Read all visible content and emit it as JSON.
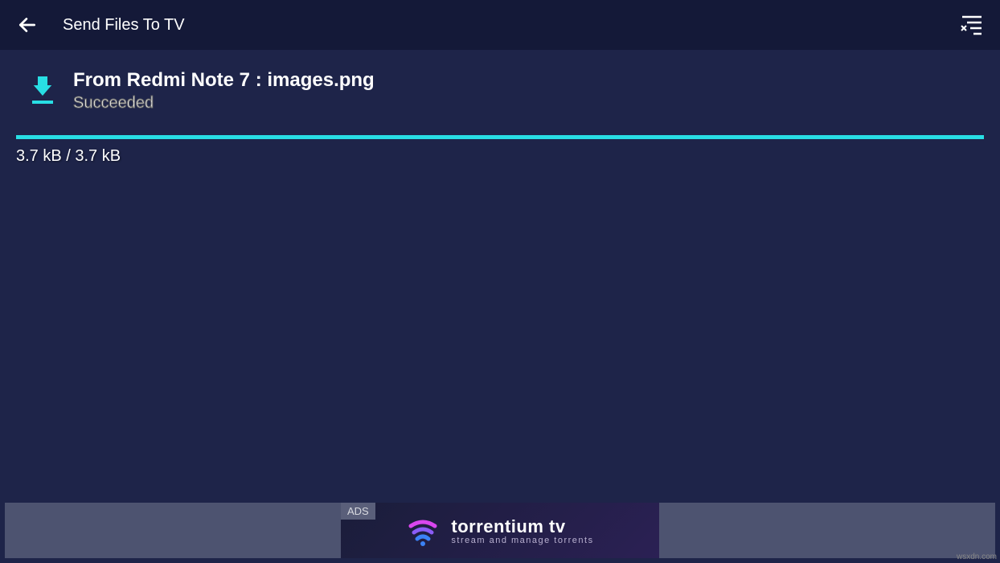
{
  "header": {
    "title": "Send Files To TV"
  },
  "transfer": {
    "title": "From Redmi Note 7 : images.png",
    "status": "Succeeded",
    "size_text": "3.7 kB / 3.7 kB",
    "progress_percent": 100
  },
  "ad": {
    "label": "ADS",
    "brand_title": "torrentium tv",
    "brand_subtitle": "stream and manage torrents"
  },
  "colors": {
    "accent": "#28dee4",
    "header_bg": "#141938",
    "body_bg": "#1e2449"
  },
  "watermark": "wsxdn.com"
}
